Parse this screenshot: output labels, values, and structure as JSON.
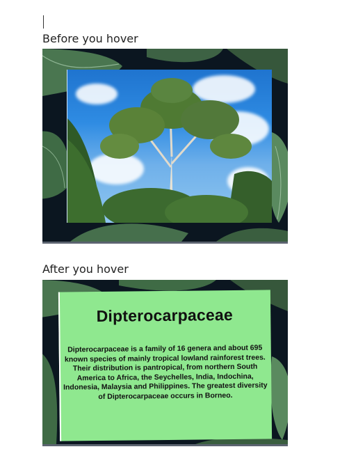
{
  "sections": {
    "before_label": "Before you hover",
    "after_label": "After you hover"
  },
  "overlay": {
    "title": "Dipterocarpaceae",
    "body": "Dipterocarpaceae is a family of 16 genera and about 695 known species of mainly tropical lowland rainforest trees. Their distribution is pantropical, from northern South America to Africa, the Seychelles, India, Indochina, Indonesia, Malaysia and Philippines. The greatest diversity of Dipterocarpaceae occurs in Borneo."
  },
  "colors": {
    "overlay_background": "#8fe88f",
    "card_background": "#0b1620",
    "sky": "#2f8ce3",
    "leaf": "#3f6b45"
  }
}
